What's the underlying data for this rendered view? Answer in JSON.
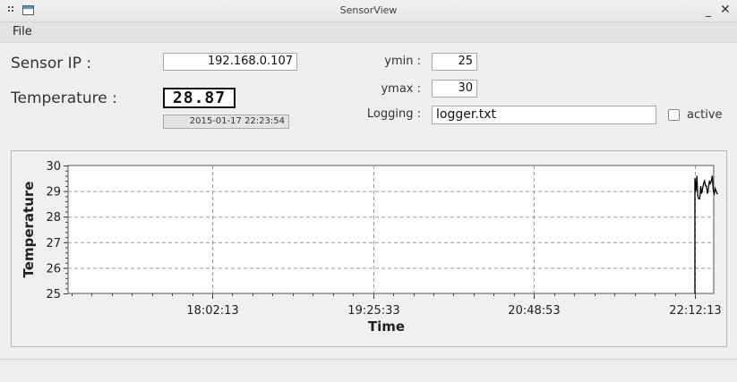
{
  "window": {
    "title": "SensorView"
  },
  "menu": {
    "file": "File"
  },
  "sensor": {
    "ip_label": "Sensor IP :",
    "ip_value": "192.168.0.107",
    "temp_label": "Temperature :",
    "temp_value": "28.87",
    "timestamp": "2015-01-17 22:23:54"
  },
  "controls": {
    "ymin_label": "ymin :",
    "ymin_value": "25",
    "ymax_label": "ymax :",
    "ymax_value": "30",
    "logging_label": "Logging :",
    "logging_value": "logger.txt",
    "active_label": "active",
    "active_checked": false
  },
  "chart_data": {
    "type": "line",
    "xlabel": "Time",
    "ylabel": "Temperature",
    "ylim": [
      25,
      30
    ],
    "yticks": [
      25,
      26,
      27,
      28,
      29,
      30
    ],
    "xticks": [
      "18:02:13",
      "19:25:33",
      "20:48:53",
      "22:12:13"
    ],
    "grid": true,
    "series": [
      {
        "x": [
          "22:12:13",
          "22:12:13",
          "22:12:43",
          "22:13:13",
          "22:13:43",
          "22:14:13",
          "22:14:43",
          "22:15:13",
          "22:15:43",
          "22:16:13",
          "22:16:43",
          "22:17:13",
          "22:17:43",
          "22:18:13",
          "22:18:43",
          "22:19:13",
          "22:19:43",
          "22:20:13",
          "22:20:43",
          "22:21:13",
          "22:21:43",
          "22:22:13",
          "22:22:43",
          "22:23:13",
          "22:23:54"
        ],
        "values": [
          25.0,
          29.5,
          29.0,
          29.6,
          28.8,
          28.7,
          28.7,
          29.2,
          28.9,
          29.1,
          29.3,
          29.4,
          29.2,
          29.2,
          28.9,
          29.1,
          29.4,
          29.3,
          29.4,
          29.6,
          29.0,
          28.9,
          29.1,
          29.0,
          28.87
        ]
      }
    ]
  }
}
